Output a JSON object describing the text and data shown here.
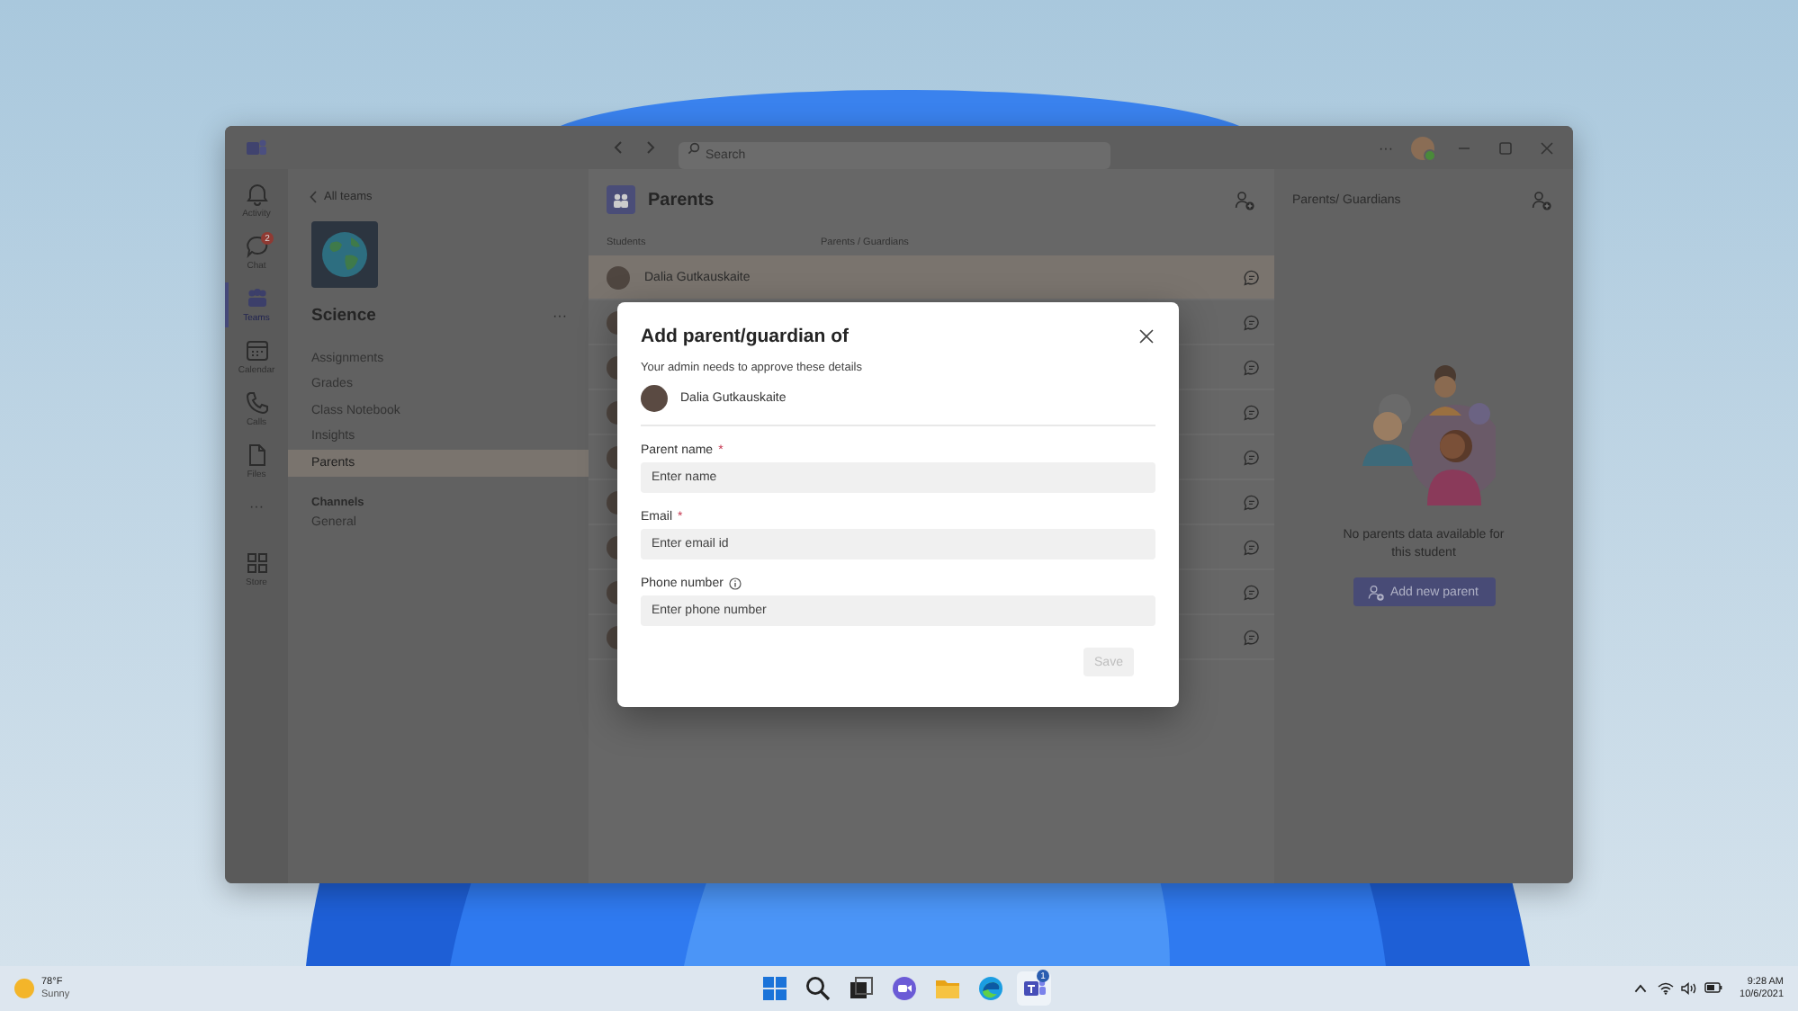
{
  "title_bar": {
    "search": {
      "placeholder": "Search"
    },
    "more": "···"
  },
  "rail": {
    "items": [
      {
        "label": "Activity",
        "kind": "bell",
        "selected": false
      },
      {
        "label": "Chat",
        "kind": "chat",
        "badge": "2",
        "selected": false
      },
      {
        "label": "Teams",
        "kind": "teams",
        "selected": true
      },
      {
        "label": "Calendar",
        "kind": "calendar",
        "selected": false
      },
      {
        "label": "Calls",
        "kind": "phone",
        "selected": false
      },
      {
        "label": "Files",
        "kind": "file",
        "selected": false
      }
    ],
    "more": "···",
    "bottom": {
      "label": "Store",
      "kind": "store",
      "selected": false
    }
  },
  "sidebar": {
    "back": "All teams",
    "team": "Science",
    "more": "···",
    "items": [
      {
        "label": "Assignments",
        "selected": false
      },
      {
        "label": "Grades",
        "selected": false
      },
      {
        "label": "Class Notebook",
        "selected": false
      },
      {
        "label": "Insights",
        "selected": false
      },
      {
        "label": "Parents",
        "selected": true
      }
    ],
    "channels_heading": "Channels",
    "channels": [
      {
        "label": "General",
        "selected": false
      }
    ]
  },
  "main": {
    "title": "Parents",
    "columns": [
      "Students",
      "Parents / Guardians"
    ],
    "rows": [
      {
        "name": "Dalia Gutkauskaite",
        "selected": true
      },
      {
        "selected": false
      },
      {
        "selected": false
      },
      {
        "selected": false
      },
      {
        "selected": false
      },
      {
        "selected": false
      },
      {
        "selected": false
      },
      {
        "selected": false
      },
      {
        "selected": false
      }
    ]
  },
  "right_panel": {
    "title": "Parents/ Guardians",
    "empty_text": "No parents data available for this student",
    "button": "Add new parent"
  },
  "dialog": {
    "title": "Add parent/guardian of",
    "subtitle": "Your admin needs to approve these details",
    "student": "Dalia Gutkauskaite",
    "fields": [
      {
        "label": "Parent name",
        "required": true,
        "required_mark": "*",
        "info": false,
        "placeholder": "Enter name"
      },
      {
        "label": "Email",
        "required": true,
        "required_mark": "*",
        "info": false,
        "placeholder": "Enter email id"
      },
      {
        "label": "Phone number",
        "required": false,
        "info": true,
        "placeholder": "Enter phone number"
      }
    ],
    "save": {
      "label": "Save",
      "disabled": true
    }
  },
  "taskbar": {
    "weather": {
      "temp": "78°F",
      "condition": "Sunny"
    },
    "apps": [
      {
        "kind": "start",
        "active": false
      },
      {
        "kind": "search",
        "active": false
      },
      {
        "kind": "taskview",
        "active": false
      },
      {
        "kind": "chat",
        "active": false
      },
      {
        "kind": "explorer",
        "active": false
      },
      {
        "kind": "edge",
        "active": false
      },
      {
        "kind": "teams",
        "active": true,
        "badge": "1"
      }
    ],
    "time": "9:28 AM",
    "date": "10/6/2021"
  }
}
